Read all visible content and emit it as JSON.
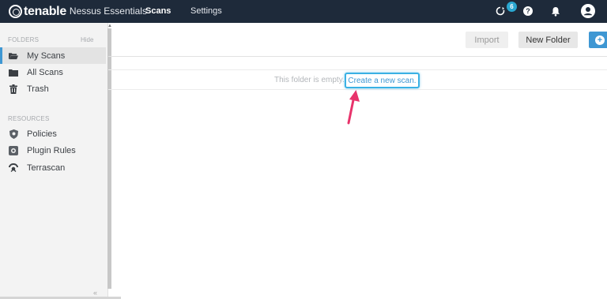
{
  "header": {
    "logo_text": "tenable",
    "product_name": "Nessus Essentials",
    "nav": [
      {
        "label": "Scans",
        "active": true
      },
      {
        "label": "Settings",
        "active": false
      }
    ],
    "notification_count": "6",
    "icons": [
      "sync-icon",
      "help-icon",
      "bell-icon",
      "user-icon"
    ],
    "colors": {
      "bar": "#1e2a3a",
      "badge": "#2aa7d1"
    }
  },
  "sidebar": {
    "folders_label": "FOLDERS",
    "hide_label": "Hide",
    "folders": [
      {
        "label": "My Scans",
        "icon": "folder-open-icon",
        "active": true
      },
      {
        "label": "All Scans",
        "icon": "folder-icon",
        "active": false
      },
      {
        "label": "Trash",
        "icon": "trash-icon",
        "active": false
      }
    ],
    "resources_label": "RESOURCES",
    "resources": [
      {
        "label": "Policies",
        "icon": "shield-icon"
      },
      {
        "label": "Plugin Rules",
        "icon": "plugin-rules-icon"
      },
      {
        "label": "Terrascan",
        "icon": "terrascan-icon"
      }
    ],
    "collapse_glyph": "«"
  },
  "toolbar": {
    "import_label": "Import",
    "new_folder_label": "New Folder",
    "new_scan_glyph": "+",
    "accent_color": "#3e97d3"
  },
  "main": {
    "empty_message": "This folder is empty.",
    "create_link": "Create a new scan."
  },
  "annotation": {
    "highlight_color": "#3ab1e4",
    "arrow_color": "#e8336b"
  }
}
